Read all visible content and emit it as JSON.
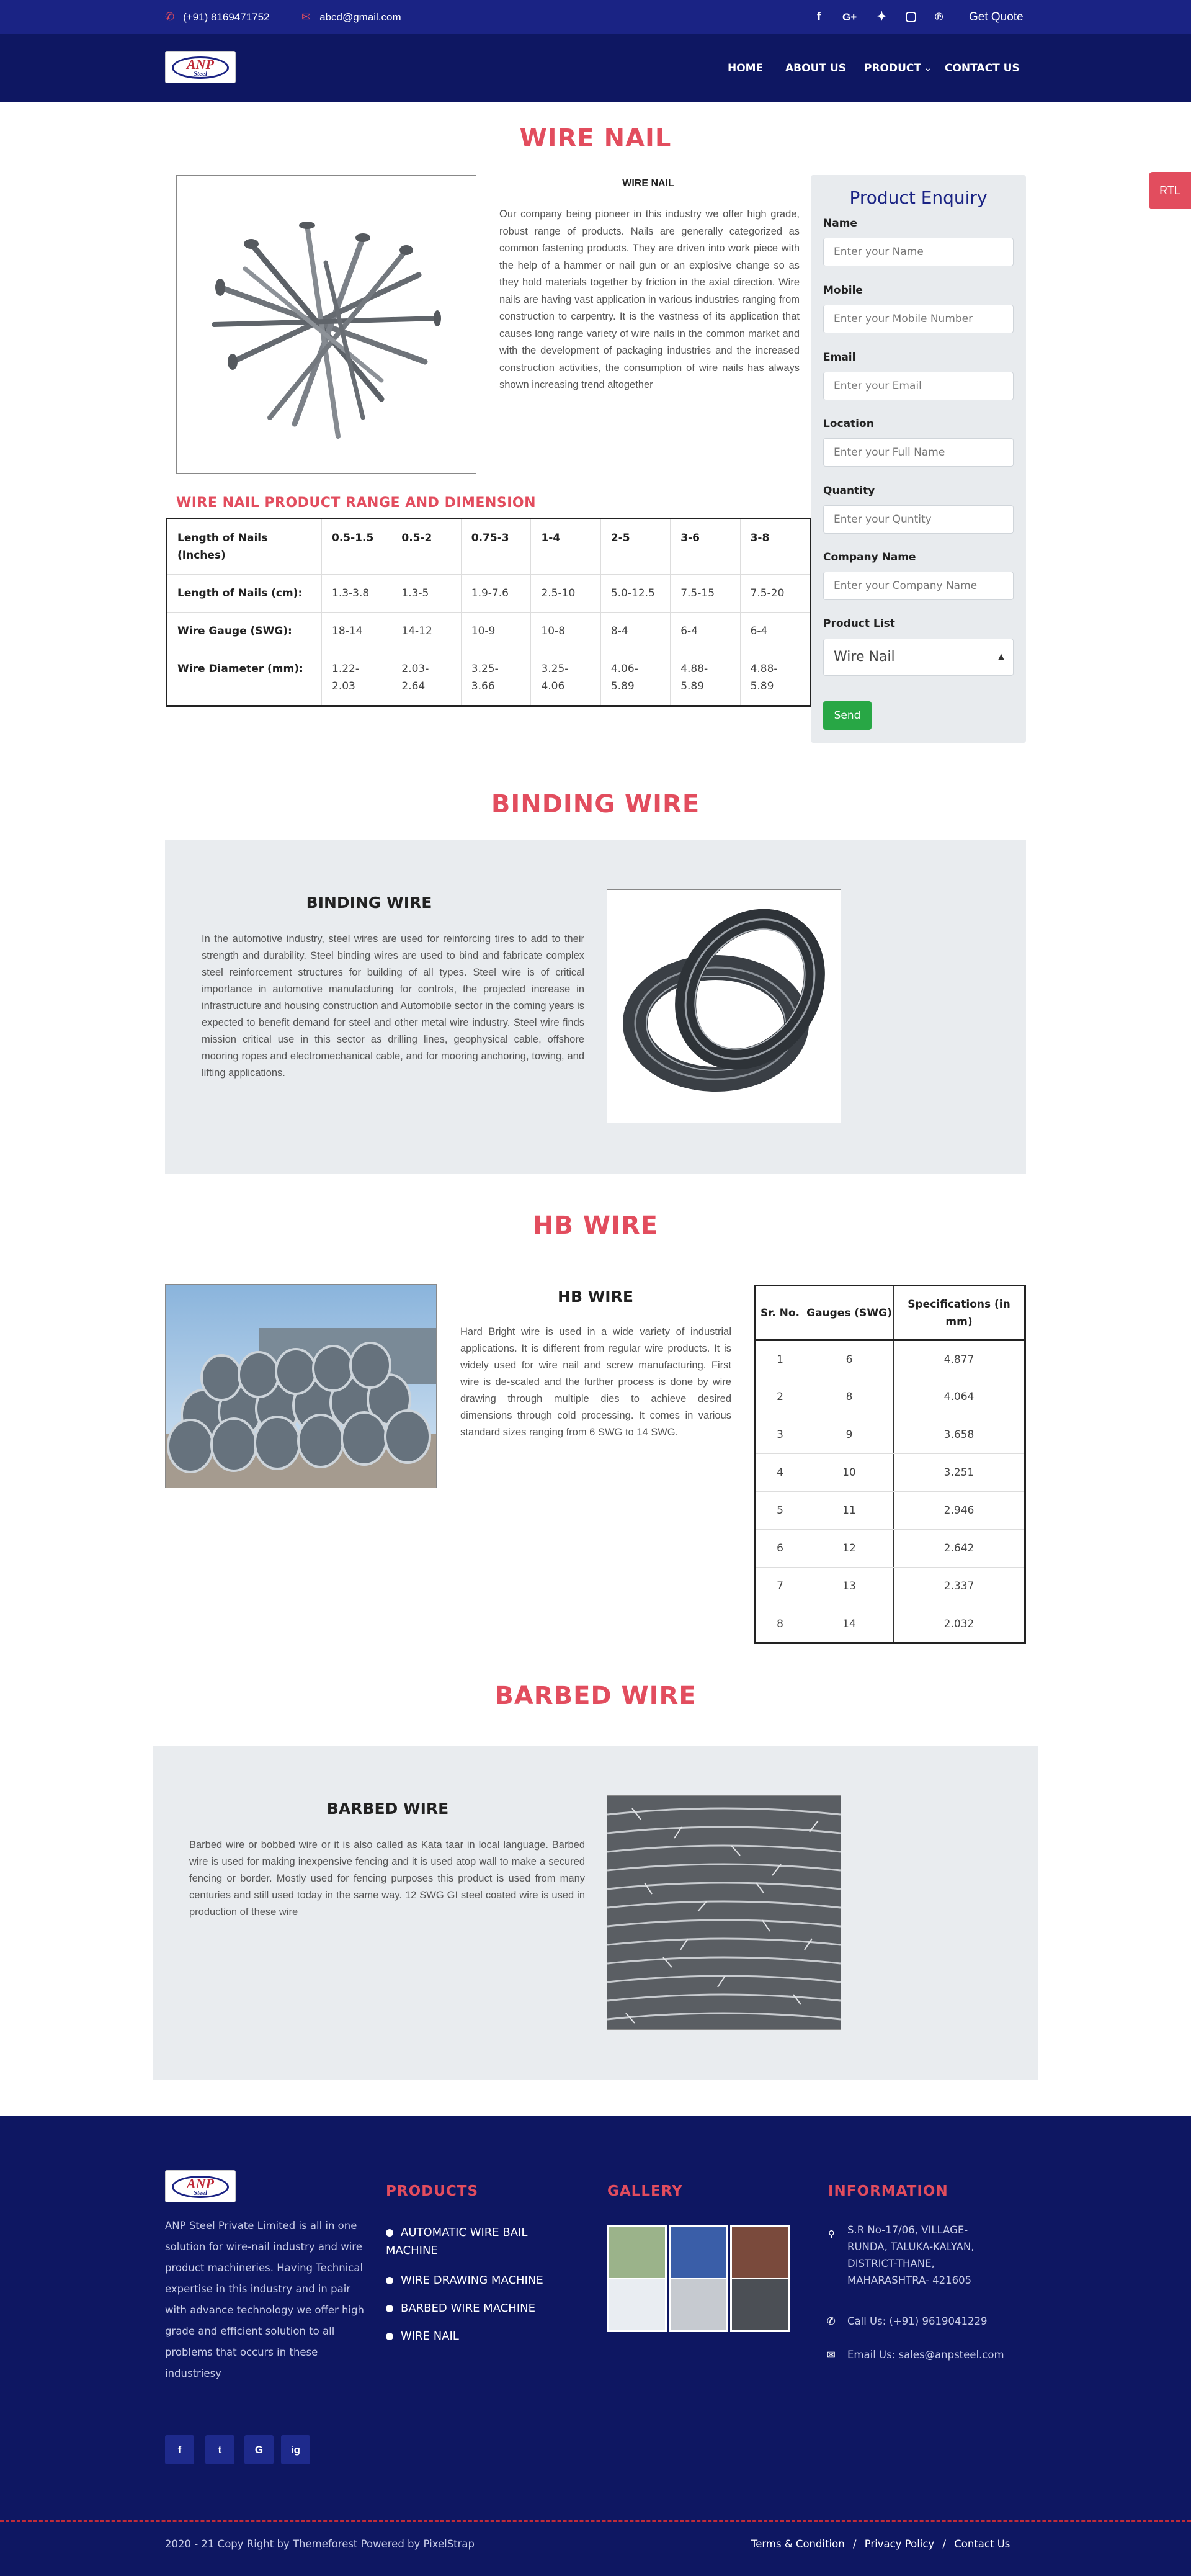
{
  "topbar": {
    "phone": "(+91) 8169471752",
    "email": "abcd@gmail.com",
    "quote": "Get Quote",
    "social_icons": [
      "facebook-icon",
      "google-plus-icon",
      "twitter-icon",
      "instagram-icon",
      "rss-icon"
    ]
  },
  "nav": {
    "logo_text": "ANP",
    "logo_sub": "Steel",
    "items": [
      {
        "label": "HOME"
      },
      {
        "label": "ABOUT US"
      },
      {
        "label": "PRODUCT"
      },
      {
        "label": "CONTACT US"
      }
    ]
  },
  "rtl": "RTL",
  "wire_nail": {
    "title": "WIRE NAIL",
    "subtitle": "WIRE NAIL",
    "description": "Our company being pioneer in this industry we offer high grade, robust range of products. Nails are generally categorized as common fastening products. They are driven into work piece with the help of a hammer or nail gun or an explosive change so as they hold materials together by friction in the axial direction. Wire nails are having vast application in various industries ranging from construction to carpentry. It is the vastness of its application that causes long range variety of wire nails in the common market and with the development of packaging industries and the increased construction activities, the consumption of wire nails has always shown increasing trend altogether",
    "range_title": "WIRE NAIL PRODUCT RANGE AND DIMENSION",
    "table": {
      "headers": [
        "Length of Nails (Inches)",
        "0.5-1.5",
        "0.5-2",
        "0.75-3",
        "1-4",
        "2-5",
        "3-6",
        "3-8"
      ],
      "rows": [
        [
          "Length of Nails (cm):",
          "1.3-3.8",
          "1.3-5",
          "1.9-7.6",
          "2.5-10",
          "5.0-12.5",
          "7.5-15",
          "7.5-20"
        ],
        [
          "Wire Gauge (SWG):",
          "18-14",
          "14-12",
          "10-9",
          "10-8",
          "8-4",
          "6-4",
          "6-4"
        ],
        [
          "Wire Diameter (mm):",
          "1.22-2.03",
          "2.03-2.64",
          "3.25-3.66",
          "3.25-4.06",
          "4.06-5.89",
          "4.88-5.89",
          "4.88-5.89"
        ]
      ]
    }
  },
  "enquiry": {
    "title": "Product Enquiry",
    "fields": [
      {
        "label": "Name",
        "placeholder": "Enter your  Name"
      },
      {
        "label": "Mobile",
        "placeholder": "Enter your Mobile Number"
      },
      {
        "label": "Email",
        "placeholder": "Enter your Email"
      },
      {
        "label": "Location",
        "placeholder": "Enter your Full Name"
      },
      {
        "label": "Quantity",
        "placeholder": "Enter your Quntity"
      },
      {
        "label": "Company Name",
        "placeholder": "Enter your Company Name"
      }
    ],
    "product_list_label": "Product List",
    "product_selected": "Wire Nail",
    "send": "Send"
  },
  "binding_wire": {
    "title": "BINDING WIRE",
    "subtitle": "BINDING WIRE",
    "description": "In the automotive industry, steel wires are used for reinforcing tires to add to their strength and durability. Steel binding wires are used to bind and fabricate complex steel reinforcement structures for building of all types. Steel wire is of critical importance in automotive manufacturing for controls, the projected increase in infrastructure and housing construction and Automobile sector in the coming years is expected to benefit demand for steel and other metal wire industry. Steel wire finds mission critical use in this sector as drilling lines, geophysical cable, offshore mooring ropes and electromechanical cable, and for mooring anchoring, towing, and lifting applications."
  },
  "hb_wire": {
    "title": "HB WIRE",
    "subtitle": "HB WIRE",
    "description": "Hard Bright wire is used in a wide variety of industrial applications. It is different from regular wire products. It is widely used for wire nail and screw manufacturing. First wire is de-scaled and the further process is done by wire drawing through multiple dies to achieve desired dimensions through cold processing. It comes in various standard sizes ranging from 6 SWG to 14 SWG.",
    "table": {
      "headers": [
        "Sr. No.",
        "Gauges (SWG)",
        "Specifications (in mm)"
      ],
      "rows": [
        [
          "1",
          "6",
          "4.877"
        ],
        [
          "2",
          "8",
          "4.064"
        ],
        [
          "3",
          "9",
          "3.658"
        ],
        [
          "4",
          "10",
          "3.251"
        ],
        [
          "5",
          "11",
          "2.946"
        ],
        [
          "6",
          "12",
          "2.642"
        ],
        [
          "7",
          "13",
          "2.337"
        ],
        [
          "8",
          "14",
          "2.032"
        ]
      ]
    }
  },
  "barbed_wire": {
    "title": "BARBED WIRE",
    "subtitle": "BARBED WIRE",
    "description": "Barbed wire or bobbed wire or it is also called as Kata taar in local language. Barbed wire is used for making inexpensive fencing and it is used atop wall to make a secured fencing or border. Mostly used for fencing purposes this product is used from many centuries and still used today in the same way. 12 SWG GI steel coated wire is used in production of these wire"
  },
  "footer": {
    "about": "ANP Steel Private Limited is all in one solution for wire-nail industry and wire product machineries. Having Technical expertise in this industry and in pair with advance technology we offer high grade and efficient solution to all problems that occurs in these industriesy",
    "products_title": "PRODUCTS",
    "products": [
      "AUTOMATIC WIRE BAIL MACHINE",
      "WIRE DRAWING MACHINE",
      "BARBED WIRE MACHINE",
      "WIRE NAIL"
    ],
    "gallery_title": "GALLERY",
    "info_title": "INFORMATION",
    "address": "S.R No-17/06, VILLAGE-RUNDA, TALUKA-KALYAN, DISTRICT-THANE, MAHARASHTRA- 421605",
    "call": "Call Us: (+91) 9619041229",
    "email": "Email Us: sales@anpsteel.com",
    "copyright": "2020 - 21 Copy Right by Themeforest Powered by PixelStrap",
    "links": [
      "Terms & Condition",
      "Privacy Policy",
      "Contact Us"
    ],
    "separator": "/",
    "social": [
      "f",
      "t",
      "G",
      "ig"
    ]
  }
}
